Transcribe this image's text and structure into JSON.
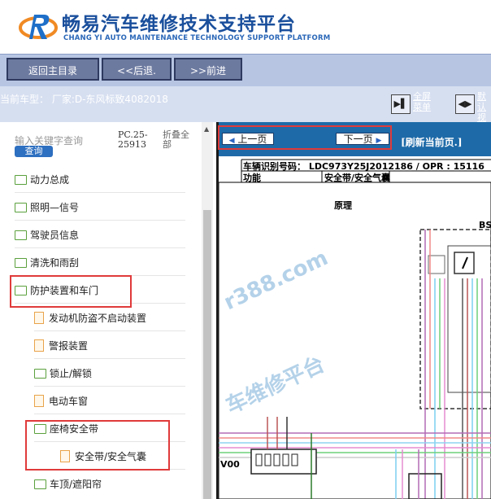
{
  "header": {
    "title": "畅易汽车维修技术支持平台",
    "subtitle": "CHANG YI AUTO MAINTENANCE TECHNOLOGY SUPPORT PLATFORM"
  },
  "nav": {
    "home": "返回主目录",
    "back": "<<后退.",
    "forward": ">>前进"
  },
  "info": {
    "vehicle": "当前车型： 厂家:D-东风标致4082018",
    "fullscreen": "全屏",
    "menu": "菜单",
    "default_1": "默认",
    "default_2": "视图"
  },
  "sidebar": {
    "search_placeholder": "输入关键字查询",
    "search_button": "查询",
    "pc_line1": "PC.25-",
    "pc_line2": "25913",
    "collapse_1": "折叠全",
    "collapse_2": "部",
    "items": [
      {
        "label": "动力总成"
      },
      {
        "label": "照明—信号"
      },
      {
        "label": "驾驶员信息"
      },
      {
        "label": "清洗和雨刮"
      },
      {
        "label": "防护装置和车门"
      },
      {
        "label": "发动机防盗不启动装置"
      },
      {
        "label": "警报装置"
      },
      {
        "label": "锁止/解锁"
      },
      {
        "label": "电动车窗"
      },
      {
        "label": "座椅安全带"
      },
      {
        "label": "安全带/安全气囊"
      },
      {
        "label": "车顶/遮阳帘"
      }
    ]
  },
  "viewer": {
    "prev": "上一页",
    "next": "下一页",
    "refresh": "[刷新当前页.]",
    "vin_label": "车辆识别号码：",
    "vin_value": "LDC973Y25J2012186 / OPR : 15116",
    "func_label": "功能",
    "func_value": "安全带/安全气囊",
    "diagram_title": "原理",
    "bsi": "BS",
    "v00": "V00",
    "watermark_1": "r388.com",
    "watermark_2": "车维修平台"
  },
  "colors": {
    "brand_blue": "#1a4f9c",
    "nav_bar": "#b7c5e3",
    "viewer_bar": "#1e6aa8",
    "highlight_red": "#e03a3a"
  }
}
